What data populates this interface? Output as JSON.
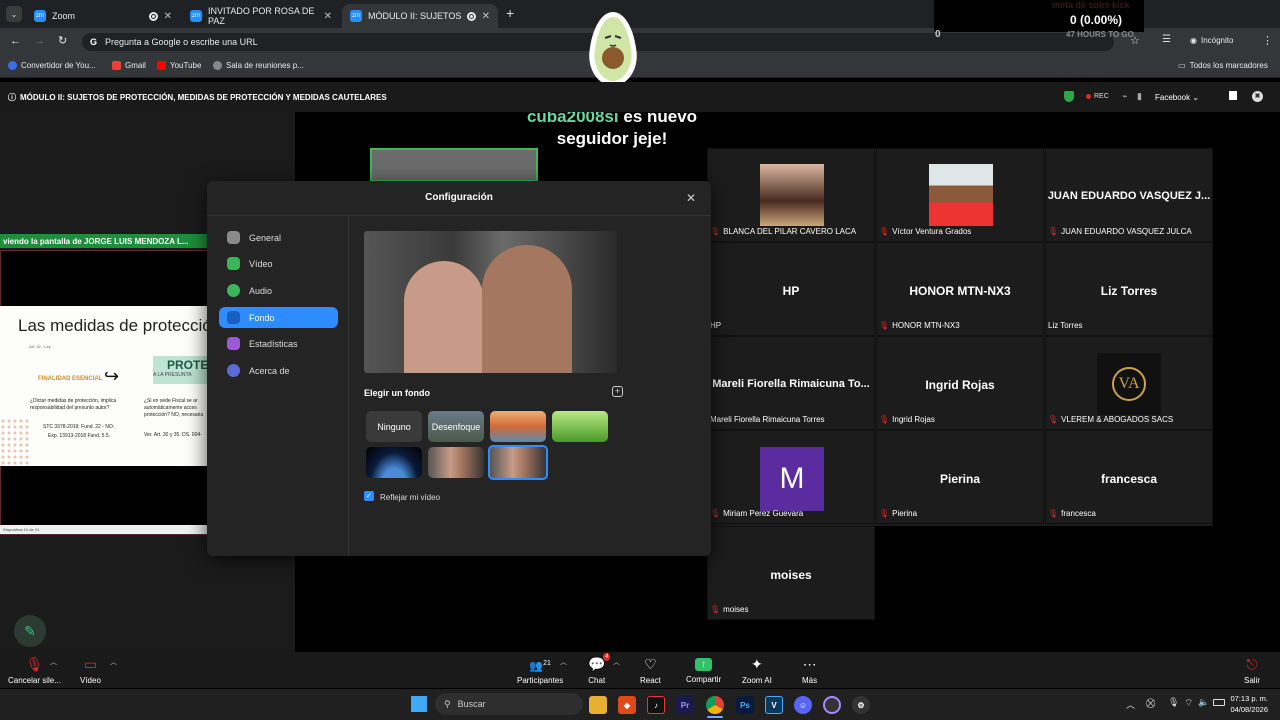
{
  "browser": {
    "tabs": [
      {
        "label": "Zoom"
      },
      {
        "label": "INVITADO POR ROSA DE PAZ"
      },
      {
        "label": "MÓDULO II: SUJETOS DE PR"
      }
    ],
    "omnibox_text": "Pregunta a Google o escribe una URL",
    "profile_label": "Incógnito",
    "bookmarks": [
      "Convertidor de You...",
      "Gmail",
      "YouTube",
      "Sala de reuniones p..."
    ],
    "all_bookmarks_label": "Todos los marcadores"
  },
  "overlay": {
    "subs_goal_label": "meta de subs kick",
    "subs_value": "0 (0.00%)",
    "subs_left": "0",
    "hours_label": "47 HOURS TO GO",
    "follower_user": "cuba2008si",
    "follower_text_1": "es nuevo",
    "follower_text_2": "seguidor jeje!"
  },
  "meeting": {
    "title": "MÓDULO II: SUJETOS DE PROTECCIÓN, MEDIDAS DE PROTECCIÓN Y MEDIDAS CAUTELARES",
    "rec_label": "REC",
    "facebook_label": "Facebook",
    "share_banner": "viendo la pantalla de  JORGE LUIS MENDOZA L...",
    "slide": {
      "title": "Las medidas de protección",
      "subtitle": "Art. 32 - Ley",
      "tag": "PROTEC",
      "tag_sub": "A LA PRESUNTA",
      "finalidad": "FINALIDAD ESENCIAL",
      "q1": "¿Dictar medidas de protección, implica responsabilidad del presunto autor?",
      "ref1": "STC 3378-2019; Fund. 22 - NO.",
      "ref2": "Exp. 13913-2018 Fund. 5.5.",
      "q2": "¿Si en sede Fiscal se ar automáticamente acces protección? NO, necesaria",
      "ref3": "Ver. Art. 30 y 35. DS. 004-",
      "footer": "Diapositiva 10 de 21"
    },
    "participants": [
      {
        "display": "",
        "label": "BLANCA DEL PILAR CAVERO LACA",
        "photo": true
      },
      {
        "display": "",
        "label": "Víctor Ventura Grados",
        "photo": true
      },
      {
        "display": "JUAN EDUARDO VASQUEZ J...",
        "label": "JUAN EDUARDO VASQUEZ JULCA"
      },
      {
        "display": "HP",
        "label": "HP"
      },
      {
        "display": "HONOR MTN-NX3",
        "label": "HONOR MTN-NX3"
      },
      {
        "display": "Liz Torres",
        "label": "Liz Torres"
      },
      {
        "display": "Mareli Fiorella Rimaicuna To...",
        "label": "Mareli Fiorella Rimaicuna Torres"
      },
      {
        "display": "Ingrid Rojas",
        "label": "Ingrid Rojas"
      },
      {
        "display": "",
        "label": "VLEREM & ABOGADOS SACS",
        "logo": "VA"
      },
      {
        "display": "M",
        "label": "Miriam Perez Guevara",
        "avatar": true
      },
      {
        "display": "Pierina",
        "label": "Pierina"
      },
      {
        "display": "francesca",
        "label": "francesca"
      },
      {
        "display": "moises",
        "label": "moises"
      }
    ]
  },
  "settings_dialog": {
    "title": "Configuración",
    "nav": [
      {
        "label": "General",
        "color": "#8a8a8a"
      },
      {
        "label": "Vídeo",
        "color": "#3cb55a"
      },
      {
        "label": "Audio",
        "color": "#3cb55a"
      },
      {
        "label": "Fondo",
        "color": "#2d8cff",
        "active": true
      },
      {
        "label": "Estadísticas",
        "color": "#9c5ad6"
      },
      {
        "label": "Acerca de",
        "color": "#5b6bd6"
      }
    ],
    "choose_bg_label": "Elegir un fondo",
    "bg_options": [
      "Ninguno",
      "Desenfoque"
    ],
    "mirror_label": "Reflejar mi vídeo",
    "mirror_checked": true
  },
  "toolbar": {
    "mute_label": "Cancelar sile...",
    "video_label": "Vídeo",
    "participants_label": "Participantes",
    "participants_count": "21",
    "chat_label": "Chat",
    "chat_badge": "4",
    "react_label": "React",
    "share_label": "Compartir",
    "zoomai_label": "Zoom AI",
    "more_label": "Más",
    "leave_label": "Salir"
  },
  "taskbar": {
    "search_placeholder": "Buscar",
    "time": "07:13 p. m.",
    "date": "04/08/2026"
  }
}
